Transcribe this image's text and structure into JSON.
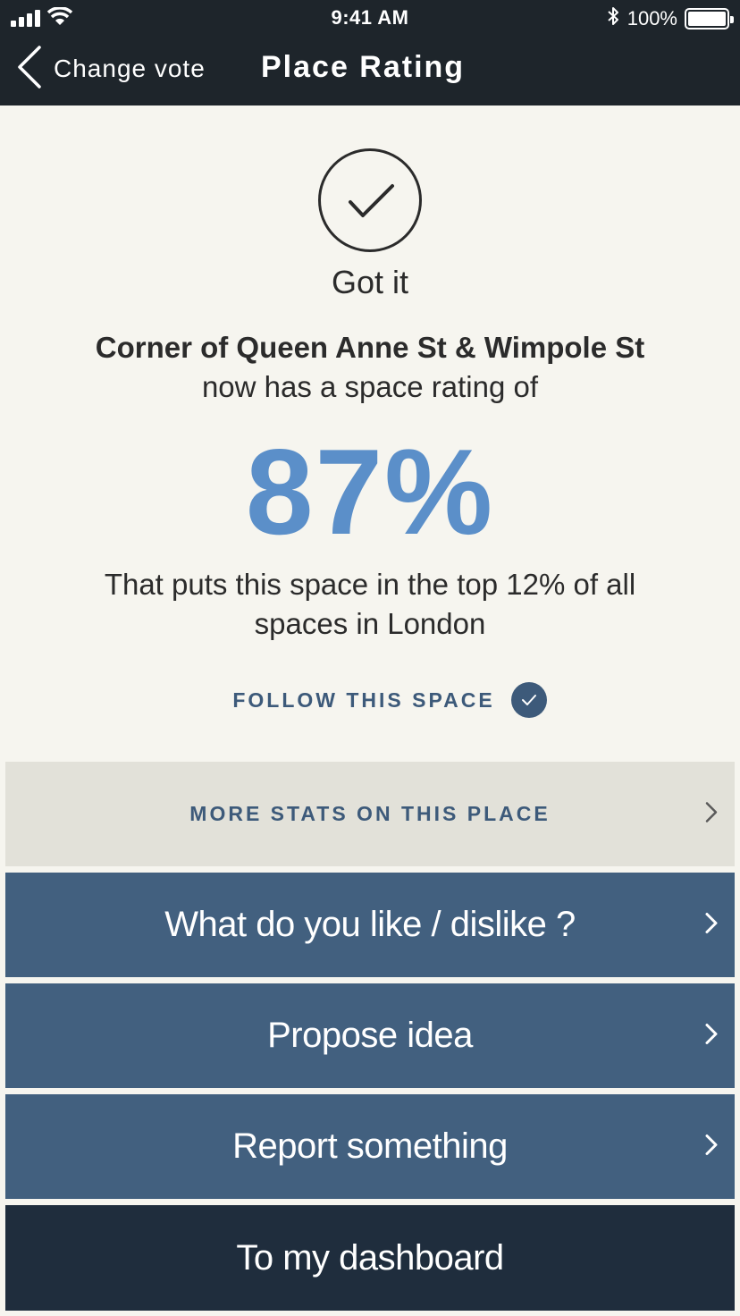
{
  "status_bar": {
    "time": "9:41 AM",
    "battery": "100%",
    "icons": [
      "signal-icon",
      "wifi-icon",
      "bluetooth-icon",
      "battery-icon"
    ]
  },
  "nav": {
    "back_label": "Change vote",
    "title": "Place Rating"
  },
  "confirmation": {
    "label": "Got it"
  },
  "result": {
    "place_name": "Corner of Queen Anne St & Wimpole St",
    "intro": "now has a space rating of",
    "rating": "87%",
    "rank_text": "That puts this space in the top 12% of all spaces in London"
  },
  "follow": {
    "label": "FOLLOW THIS SPACE",
    "following": true
  },
  "actions": {
    "stats": "MORE STATS ON THIS PLACE",
    "like": "What do you like / dislike ?",
    "propose": "Propose idea",
    "report": "Report something",
    "dashboard": "To my dashboard"
  },
  "colors": {
    "header_bg": "#1e252b",
    "page_bg": "#f6f5ef",
    "accent_blue": "#5b8fc9",
    "button_blue": "#42607f",
    "button_dark": "#1f2d3d",
    "stats_bg": "#e2e1d9",
    "label_blue": "#3d5a7a"
  }
}
